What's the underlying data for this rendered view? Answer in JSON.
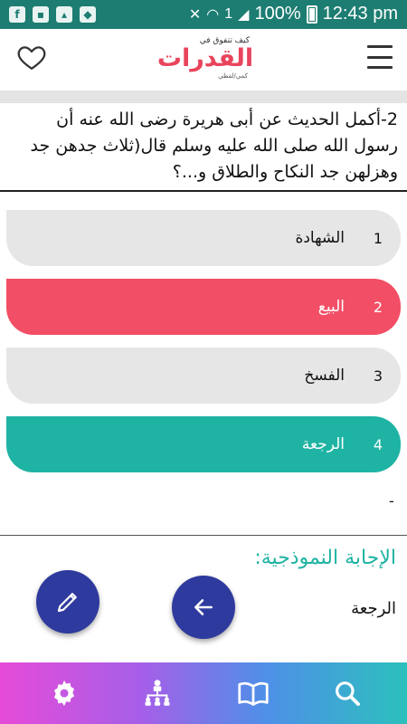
{
  "status_bar": {
    "battery_percent": "100%",
    "time": "12:43 pm",
    "sim": "1",
    "left_icons": [
      "facebook-icon",
      "image-icon",
      "gallery-icon",
      "shield-icon"
    ]
  },
  "app_bar": {
    "logo_top": "كيف تتفوق في",
    "logo_main": "القدرات",
    "logo_bottom": "كمي/لفظي",
    "favorite_icon": "heart-icon",
    "menu_icon": "hamburger-icon"
  },
  "question": {
    "text": "2-أكمل الحديث عن أبى هريرة رضى الله عنه أن رسول الله صلى الله عليه وسلم قال(ثلاث جدهن جد وهزلهن جد النكاح والطلاق و...؟"
  },
  "options": [
    {
      "number": "1",
      "label": "الشهادة",
      "state": "default"
    },
    {
      "number": "2",
      "label": "البيع",
      "state": "wrong"
    },
    {
      "number": "3",
      "label": "الفسخ",
      "state": "default"
    },
    {
      "number": "4",
      "label": "الرجعة",
      "state": "correct"
    }
  ],
  "dash_text": "-",
  "model_answer": {
    "title": "الإجابة النموذجية:",
    "answer": "الرجعة"
  },
  "colors": {
    "status_bar": "#1d7d72",
    "wrong": "#f24e65",
    "correct": "#1fb3a3",
    "fab": "#2f3a9e"
  },
  "fabs": {
    "edit_icon": "pencil-icon",
    "back_icon": "arrow-left-icon"
  },
  "bottom_nav": [
    "settings-icon",
    "hierarchy-icon",
    "book-icon",
    "search-icon"
  ]
}
